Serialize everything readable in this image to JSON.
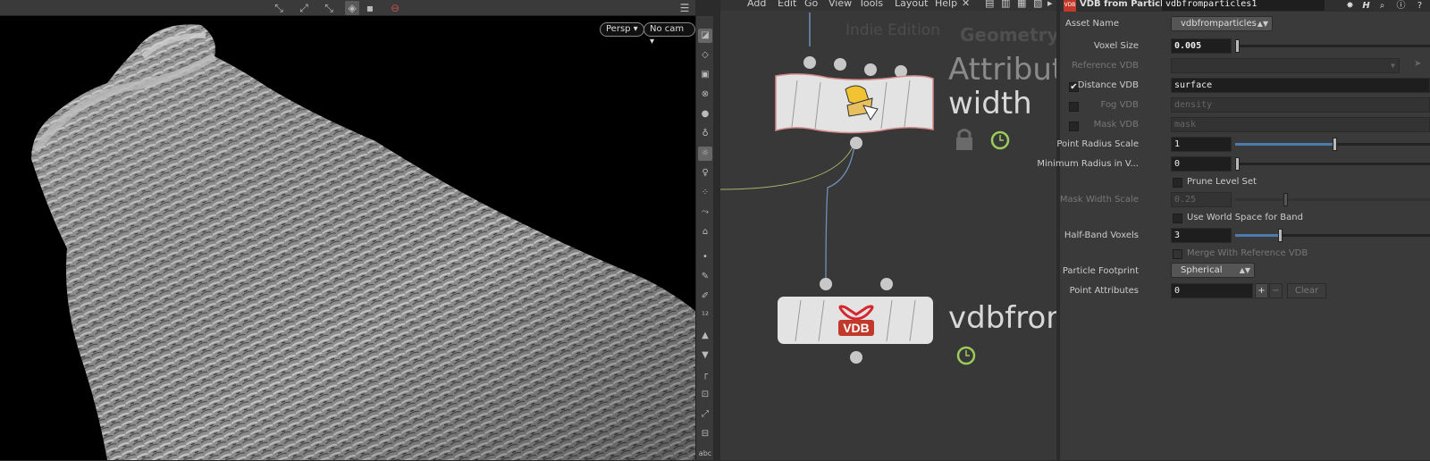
{
  "viewport": {
    "camera_label": "Persp ▾",
    "camera_view_label": "No cam ▾"
  },
  "network": {
    "menus": [
      "Add",
      "Edit",
      "Go",
      "View",
      "Tools",
      "Layout",
      "Help"
    ],
    "watermark": "Indie Edition",
    "context_label": "Geometry",
    "nodes": [
      {
        "name_line1": "Attribute",
        "name_line2": "width",
        "icon": "attribute-wrangle-icon",
        "locked": true,
        "time_dependent": true
      },
      {
        "name": "vdbfrom",
        "icon": "vdb-icon",
        "time_dependent": true
      }
    ]
  },
  "params": {
    "node_type": "VDB from Particles",
    "node_name": "vdbfromparticles1",
    "asset_name_label": "Asset Name",
    "asset_name_value": "vdbfromparticles",
    "voxel_size_label": "Voxel Size",
    "voxel_size_value": "0.005",
    "reference_vdb_label": "Reference VDB",
    "distance_vdb_label": "Distance VDB",
    "distance_vdb_value": "surface",
    "distance_vdb_checked": true,
    "fog_vdb_label": "Fog VDB",
    "fog_vdb_value": "density",
    "mask_vdb_label": "Mask VDB",
    "mask_vdb_value": "mask",
    "point_radius_scale_label": "Point Radius Scale",
    "point_radius_scale_value": "1",
    "point_radius_scale_fraction": 0.5,
    "min_radius_label": "Minimum Radius in V...",
    "min_radius_value": "0",
    "prune_level_set_label": "Prune Level Set",
    "mask_width_scale_label": "Mask Width Scale",
    "mask_width_scale_value": "0.25",
    "use_world_space_label": "Use World Space for Band",
    "half_band_label": "Half-Band Voxels",
    "half_band_value": "3",
    "half_band_fraction": 0.22,
    "merge_ref_label": "Merge With Reference VDB",
    "particle_footprint_label": "Particle Footprint",
    "particle_footprint_value": "Spherical",
    "point_attributes_label": "Point Attributes",
    "point_attributes_value": "0",
    "add_label": "+",
    "remove_label": "−",
    "clear_label": "Clear"
  },
  "colors": {
    "viewport_bg": "#000000",
    "pane_bg": "#3a3a3a",
    "network_bg": "#383838",
    "wire_green": "#a6b56a",
    "wire_blue": "#6f8fb8",
    "time_dep_green": "#9ccc5a",
    "vdb_red": "#d4262c",
    "slider_blue": "#4d7bb0"
  }
}
